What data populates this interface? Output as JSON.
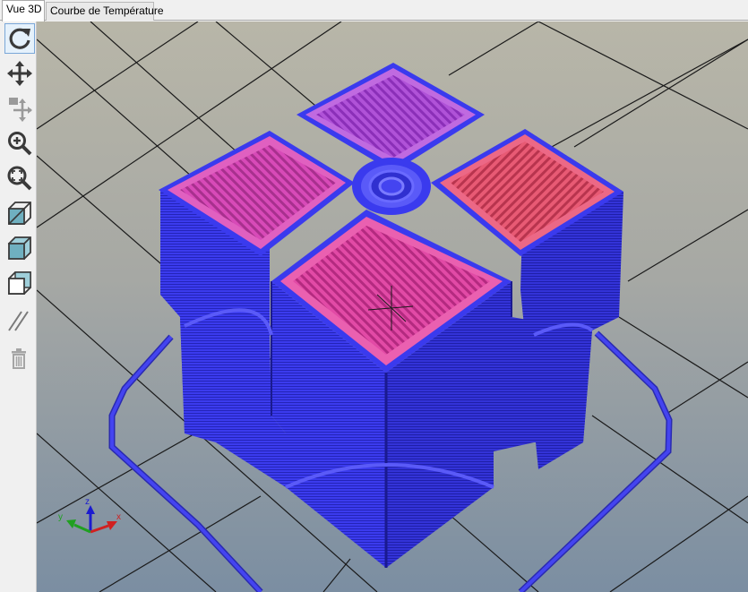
{
  "tabs": [
    {
      "label": "Vue 3D",
      "active": true
    },
    {
      "label": "Courbe de Température",
      "active": false
    }
  ],
  "toolbar": {
    "tools": [
      {
        "icon": "rotate-icon",
        "active": true
      },
      {
        "icon": "move-icon",
        "active": false
      },
      {
        "icon": "move-object-icon",
        "active": false,
        "disabled": true
      },
      {
        "icon": "zoom-in-icon",
        "active": false
      },
      {
        "icon": "zoom-fit-icon",
        "active": false
      },
      {
        "icon": "view-iso-icon",
        "active": false
      },
      {
        "icon": "view-front-icon",
        "active": false
      },
      {
        "icon": "view-box-icon",
        "active": false
      },
      {
        "icon": "slice-icon",
        "active": false
      },
      {
        "icon": "trash-icon",
        "active": false,
        "disabled": true
      }
    ]
  },
  "viewport": {
    "background_top": "#b8b6a8",
    "background_bottom": "#7e8ea0",
    "perimeter_color": "#3a3aee",
    "top_surface_colors": [
      "#b050d0",
      "#e04aa0",
      "#e04a70"
    ],
    "axes": {
      "x": "#e02020",
      "y": "#20a020",
      "z": "#2020e0"
    }
  }
}
